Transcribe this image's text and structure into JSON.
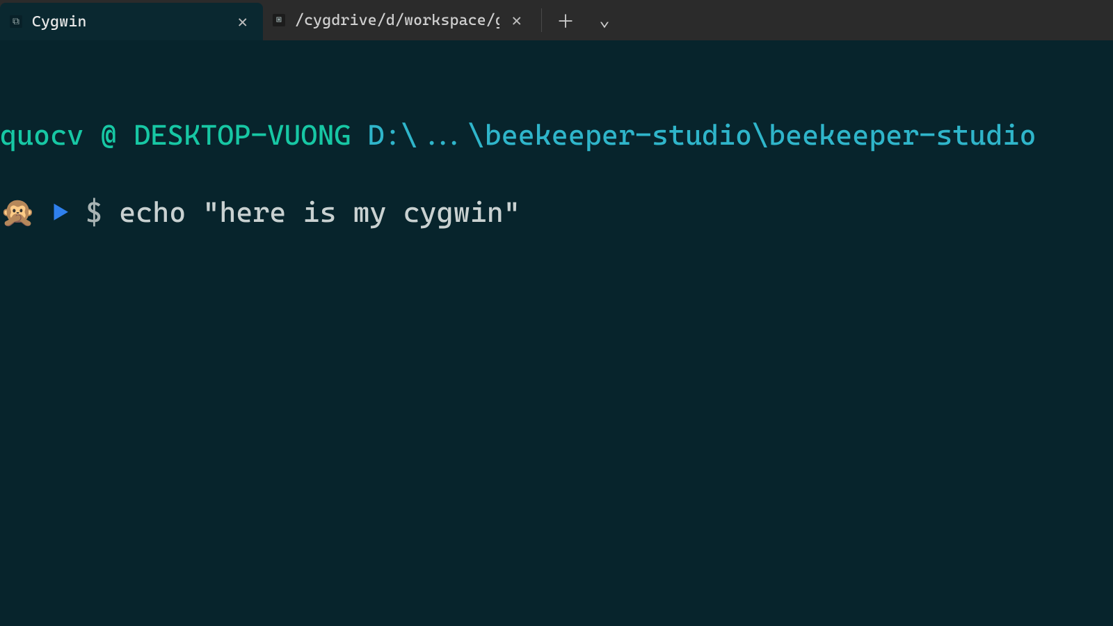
{
  "tabs": [
    {
      "title": "Cygwin",
      "icon_glyph": "⧉",
      "active": true
    },
    {
      "title": "/cygdrive/d/workspace/github.c",
      "icon_glyph": "▣",
      "active": false
    }
  ],
  "tab_controls": {
    "close_glyph": "✕",
    "new_tab_glyph": "＋",
    "dropdown_glyph": "⌄"
  },
  "prompt": {
    "user_host": "quocv @ DESKTOP-VUONG",
    "path": "D:\\...\\beekeeper-studio\\beekeeper-studio",
    "emoji": "🙊",
    "arrow": "▶",
    "dollar": "$",
    "command": "echo \"here is my cygwin\""
  }
}
